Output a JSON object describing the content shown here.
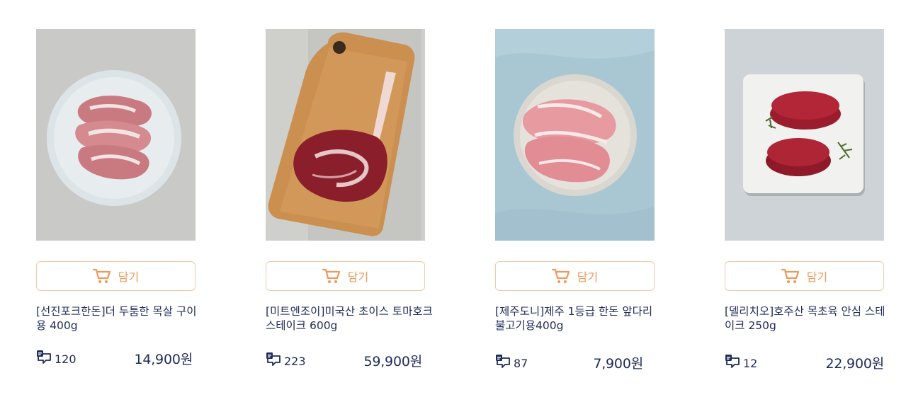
{
  "cart_label": "담기",
  "products": [
    {
      "title": "[선진포크한돈]더 두툼한 목살 구이용 400g",
      "reviews": "120",
      "price": "14,900원",
      "image": "raw pork neck slices on white plate"
    },
    {
      "title": "[미트엔조이]미국산 초이스 토마호크 스테이크 600g",
      "reviews": "223",
      "price": "59,900원",
      "image": "tomahawk steak on wooden board"
    },
    {
      "title": "[제주도니]제주 1등급 한돈 앞다리 불고기용400g",
      "reviews": "87",
      "price": "7,900원",
      "image": "sliced pork shoulder on plate"
    },
    {
      "title": "[델리치오]호주산 목초육 안심 스테이크 250g",
      "reviews": "12",
      "price": "22,900원",
      "image": "two beef tenderloin steaks on marble board"
    }
  ],
  "colors": {
    "accent": "#f0985a",
    "text": "#1f2b57",
    "button_border": "#f3c9a8"
  }
}
